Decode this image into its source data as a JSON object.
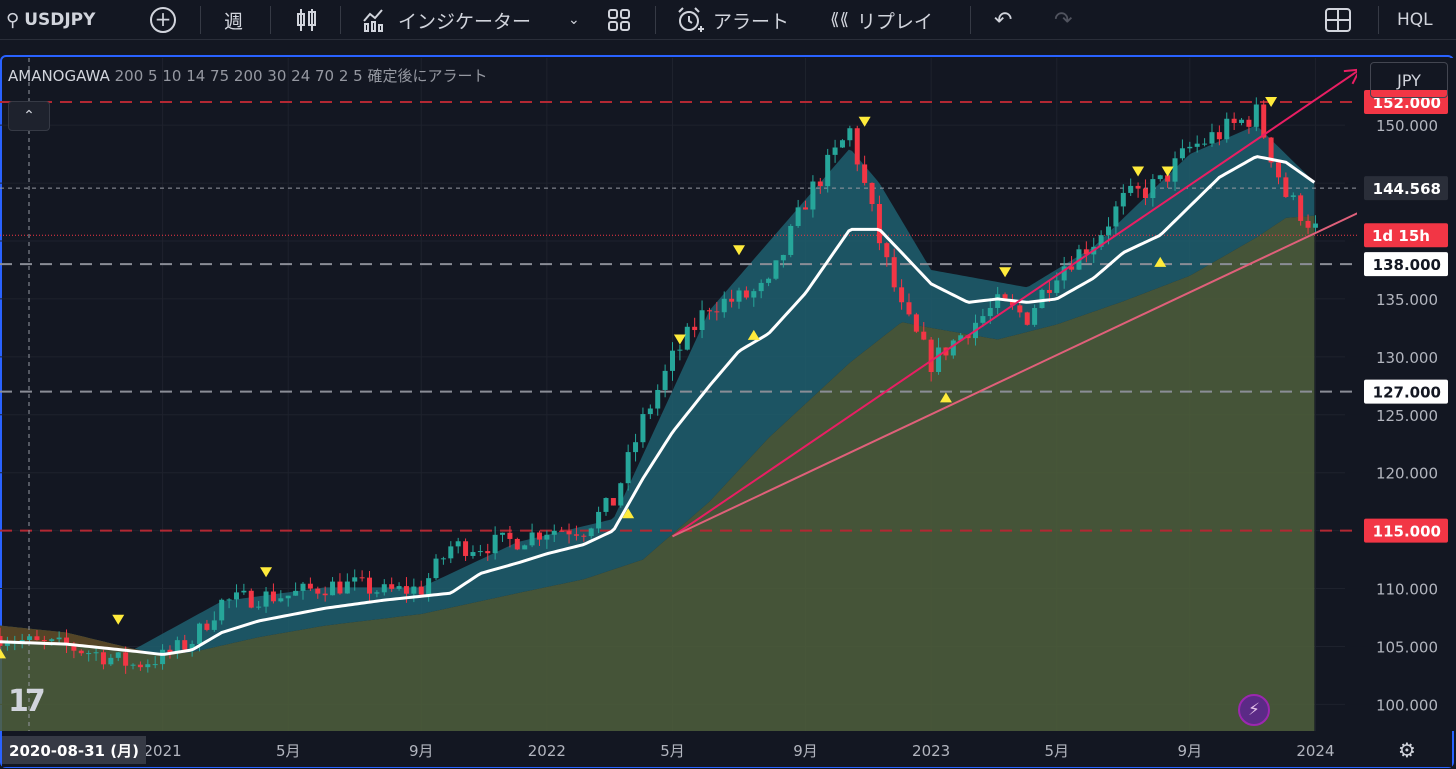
{
  "toolbar": {
    "symbol": "USDJPY",
    "interval": "週",
    "indicators_label": "インジケーター",
    "alert_label": "アラート",
    "replay_label": "リプレイ",
    "account": "HQL"
  },
  "legend": {
    "indicator_name": "AMANOGAWA",
    "params": "200 5 10 14 75 200 30 24 70 2 5 確定後にアラート"
  },
  "currency": "JPY",
  "crosshair_date": "2020-08-31 (月)",
  "colors": {
    "background": "#131722",
    "up": "#26a69a",
    "down": "#f23645",
    "teal_fill": "#1f5f6e",
    "olive_fill": "#4f5f3c",
    "brown_band": "#5a4220",
    "ma_line": "#ffffff",
    "trend_line": "#e91e63",
    "red_level": "#f23645",
    "grey_level": "#b2b5be",
    "signal": "#ffeb3b"
  },
  "chart_data": {
    "type": "candlestick",
    "symbol": "USDJPY",
    "timeframe": "weekly",
    "y_axis": {
      "ticks": [
        100.0,
        105.0,
        110.0,
        115.0,
        120.0,
        125.0,
        130.0,
        135.0,
        140.0,
        145.0,
        150.0
      ],
      "tick_labels": [
        "100.000",
        "105.000",
        "110.000",
        "115.000",
        "120.000",
        "125.000",
        "130.000",
        "135.000",
        "",
        "",
        "150.000"
      ],
      "ylim": [
        97.7,
        155.8
      ]
    },
    "x_axis": {
      "ticks": [
        "2021-01-04",
        "2021-05-03",
        "2021-09-06",
        "2022-01-03",
        "2022-05-02",
        "2022-09-05",
        "2023-01-02",
        "2023-05-01",
        "2023-09-04",
        "2024-01-01"
      ],
      "tick_labels": [
        "2021",
        "5月",
        "9月",
        "2022",
        "5月",
        "9月",
        "2023",
        "5月",
        "9月",
        "2024"
      ],
      "xlim": [
        "2020-08-03",
        "2024-01-29"
      ]
    },
    "price_labels": [
      {
        "text": "152.000",
        "value": 152.0,
        "style": "red"
      },
      {
        "text": "144.568",
        "value": 144.568,
        "style": "dark"
      },
      {
        "text": "1d 15h",
        "value": 140.5,
        "style": "red"
      },
      {
        "text": "138.000",
        "value": 138.0,
        "style": "white"
      },
      {
        "text": "127.000",
        "value": 127.0,
        "style": "white"
      },
      {
        "text": "115.000",
        "value": 115.0,
        "style": "red"
      }
    ],
    "horizontal_levels": [
      {
        "value": 152.0,
        "color": "red"
      },
      {
        "value": 138.0,
        "color": "grey"
      },
      {
        "value": 127.0,
        "color": "grey"
      },
      {
        "value": 115.0,
        "color": "red"
      }
    ],
    "closes": [
      [
        "2020-08-03",
        105.9
      ],
      [
        "2020-09-07",
        105.2
      ],
      [
        "2020-10-05",
        105.0
      ],
      [
        "2020-11-02",
        104.4
      ],
      [
        "2020-12-07",
        103.4
      ],
      [
        "2021-01-04",
        104.1
      ],
      [
        "2021-02-01",
        105.5
      ],
      [
        "2021-03-01",
        108.8
      ],
      [
        "2021-04-05",
        109.3
      ],
      [
        "2021-05-03",
        109.4
      ],
      [
        "2021-06-07",
        110.2
      ],
      [
        "2021-07-05",
        110.3
      ],
      [
        "2021-08-02",
        109.7
      ],
      [
        "2021-09-06",
        110.0
      ],
      [
        "2021-10-04",
        113.6
      ],
      [
        "2021-11-01",
        113.7
      ],
      [
        "2021-12-06",
        114.2
      ],
      [
        "2022-01-03",
        115.1
      ],
      [
        "2022-02-07",
        115.2
      ],
      [
        "2022-03-07",
        117.5
      ],
      [
        "2022-04-04",
        124.5
      ],
      [
        "2022-05-02",
        129.8
      ],
      [
        "2022-06-06",
        134.5
      ],
      [
        "2022-07-04",
        135.0
      ],
      [
        "2022-08-01",
        136.0
      ],
      [
        "2022-09-05",
        143.5
      ],
      [
        "2022-10-17",
        149.5
      ],
      [
        "2022-11-14",
        140.0
      ],
      [
        "2022-12-05",
        134.0
      ],
      [
        "2023-01-02",
        129.5
      ],
      [
        "2023-02-06",
        132.5
      ],
      [
        "2023-03-06",
        134.5
      ],
      [
        "2023-04-03",
        133.5
      ],
      [
        "2023-05-01",
        137.5
      ],
      [
        "2023-06-05",
        140.0
      ],
      [
        "2023-07-03",
        143.5
      ],
      [
        "2023-08-07",
        145.0
      ],
      [
        "2023-09-04",
        148.0
      ],
      [
        "2023-10-02",
        149.3
      ],
      [
        "2023-11-06",
        151.0
      ],
      [
        "2023-12-04",
        144.0
      ],
      [
        "2024-01-01",
        141.0
      ]
    ],
    "ma_line": [
      [
        "2020-08-03",
        105.4
      ],
      [
        "2020-10-05",
        105.2
      ],
      [
        "2020-12-07",
        104.6
      ],
      [
        "2021-01-04",
        104.3
      ],
      [
        "2021-02-01",
        104.7
      ],
      [
        "2021-03-01",
        106.2
      ],
      [
        "2021-04-05",
        107.2
      ],
      [
        "2021-06-07",
        108.3
      ],
      [
        "2021-08-02",
        109.0
      ],
      [
        "2021-10-04",
        109.6
      ],
      [
        "2021-11-01",
        111.3
      ],
      [
        "2021-12-06",
        112.2
      ],
      [
        "2022-01-03",
        113.0
      ],
      [
        "2022-02-07",
        113.8
      ],
      [
        "2022-03-07",
        115.0
      ],
      [
        "2022-04-04",
        119.5
      ],
      [
        "2022-05-02",
        123.5
      ],
      [
        "2022-06-06",
        127.5
      ],
      [
        "2022-07-04",
        130.5
      ],
      [
        "2022-08-01",
        132.0
      ],
      [
        "2022-09-05",
        135.5
      ],
      [
        "2022-10-17",
        141.0
      ],
      [
        "2022-11-14",
        141.0
      ],
      [
        "2022-12-05",
        139.0
      ],
      [
        "2023-01-02",
        136.3
      ],
      [
        "2023-02-06",
        134.7
      ],
      [
        "2023-03-06",
        135.0
      ],
      [
        "2023-04-03",
        134.7
      ],
      [
        "2023-05-01",
        135.0
      ],
      [
        "2023-06-05",
        136.8
      ],
      [
        "2023-07-03",
        139.0
      ],
      [
        "2023-08-07",
        140.5
      ],
      [
        "2023-09-04",
        143.0
      ],
      [
        "2023-10-02",
        145.5
      ],
      [
        "2023-11-06",
        147.3
      ],
      [
        "2023-12-04",
        146.8
      ],
      [
        "2024-01-01",
        145.0
      ]
    ],
    "teal_cloud_upper": [
      [
        "2020-08-03",
        106.0
      ],
      [
        "2020-12-07",
        104.7
      ],
      [
        "2021-03-01",
        108.9
      ],
      [
        "2021-06-07",
        110.1
      ],
      [
        "2021-09-06",
        110.1
      ],
      [
        "2021-12-06",
        114.0
      ],
      [
        "2022-03-07",
        116.0
      ],
      [
        "2022-06-06",
        134.0
      ],
      [
        "2022-10-17",
        148.0
      ],
      [
        "2022-11-14",
        145.0
      ],
      [
        "2023-01-02",
        137.5
      ],
      [
        "2023-04-03",
        136.0
      ],
      [
        "2023-06-05",
        139.5
      ],
      [
        "2023-09-04",
        147.5
      ],
      [
        "2023-11-06",
        150.0
      ],
      [
        "2024-01-01",
        145.0
      ]
    ],
    "olive_cloud_upper": [
      [
        "2020-08-03",
        106.8
      ],
      [
        "2020-10-05",
        106.2
      ],
      [
        "2020-12-07",
        104.8
      ],
      [
        "2021-01-04",
        104.3
      ],
      [
        "2021-02-01",
        104.5
      ],
      [
        "2021-04-05",
        105.8
      ],
      [
        "2021-06-07",
        106.8
      ],
      [
        "2021-09-06",
        107.8
      ],
      [
        "2021-12-06",
        109.6
      ],
      [
        "2022-02-07",
        110.8
      ],
      [
        "2022-04-04",
        112.5
      ],
      [
        "2022-06-06",
        117.5
      ],
      [
        "2022-08-01",
        123.0
      ],
      [
        "2022-10-17",
        129.5
      ],
      [
        "2022-12-05",
        133.0
      ],
      [
        "2023-01-02",
        132.5
      ],
      [
        "2023-03-06",
        131.5
      ],
      [
        "2023-05-01",
        132.8
      ],
      [
        "2023-07-03",
        134.8
      ],
      [
        "2023-09-04",
        137.0
      ],
      [
        "2023-11-06",
        140.3
      ],
      [
        "2023-12-04",
        142.0
      ],
      [
        "2024-01-01",
        142.2
      ]
    ],
    "signals": [
      {
        "type": "sell",
        "date": "2020-11-23",
        "value": 107.3
      },
      {
        "type": "buy",
        "date": "2020-08-03",
        "value": 104.4
      },
      {
        "type": "sell",
        "date": "2021-04-12",
        "value": 111.4
      },
      {
        "type": "buy",
        "date": "2022-03-21",
        "value": 116.5
      },
      {
        "type": "sell",
        "date": "2022-05-09",
        "value": 131.5
      },
      {
        "type": "sell",
        "date": "2022-07-04",
        "value": 139.2
      },
      {
        "type": "buy",
        "date": "2022-07-18",
        "value": 131.9
      },
      {
        "type": "sell",
        "date": "2022-10-31",
        "value": 150.3
      },
      {
        "type": "buy",
        "date": "2023-01-16",
        "value": 126.5
      },
      {
        "type": "sell",
        "date": "2023-03-13",
        "value": 137.3
      },
      {
        "type": "sell",
        "date": "2023-07-17",
        "value": 146.0
      },
      {
        "type": "sell",
        "date": "2023-08-14",
        "value": 146.0
      },
      {
        "type": "buy",
        "date": "2023-08-07",
        "value": 138.2
      },
      {
        "type": "sell",
        "date": "2023-11-20",
        "value": 152.0
      }
    ],
    "trend_lines": [
      {
        "from": [
          "2022-05-02",
          114.5
        ],
        "to": [
          "2024-02-12",
          154.8
        ],
        "arrow": true
      },
      {
        "from": [
          "2022-05-02",
          114.5
        ],
        "to": [
          "2024-02-26",
          143.1
        ],
        "arrow": true
      }
    ]
  }
}
